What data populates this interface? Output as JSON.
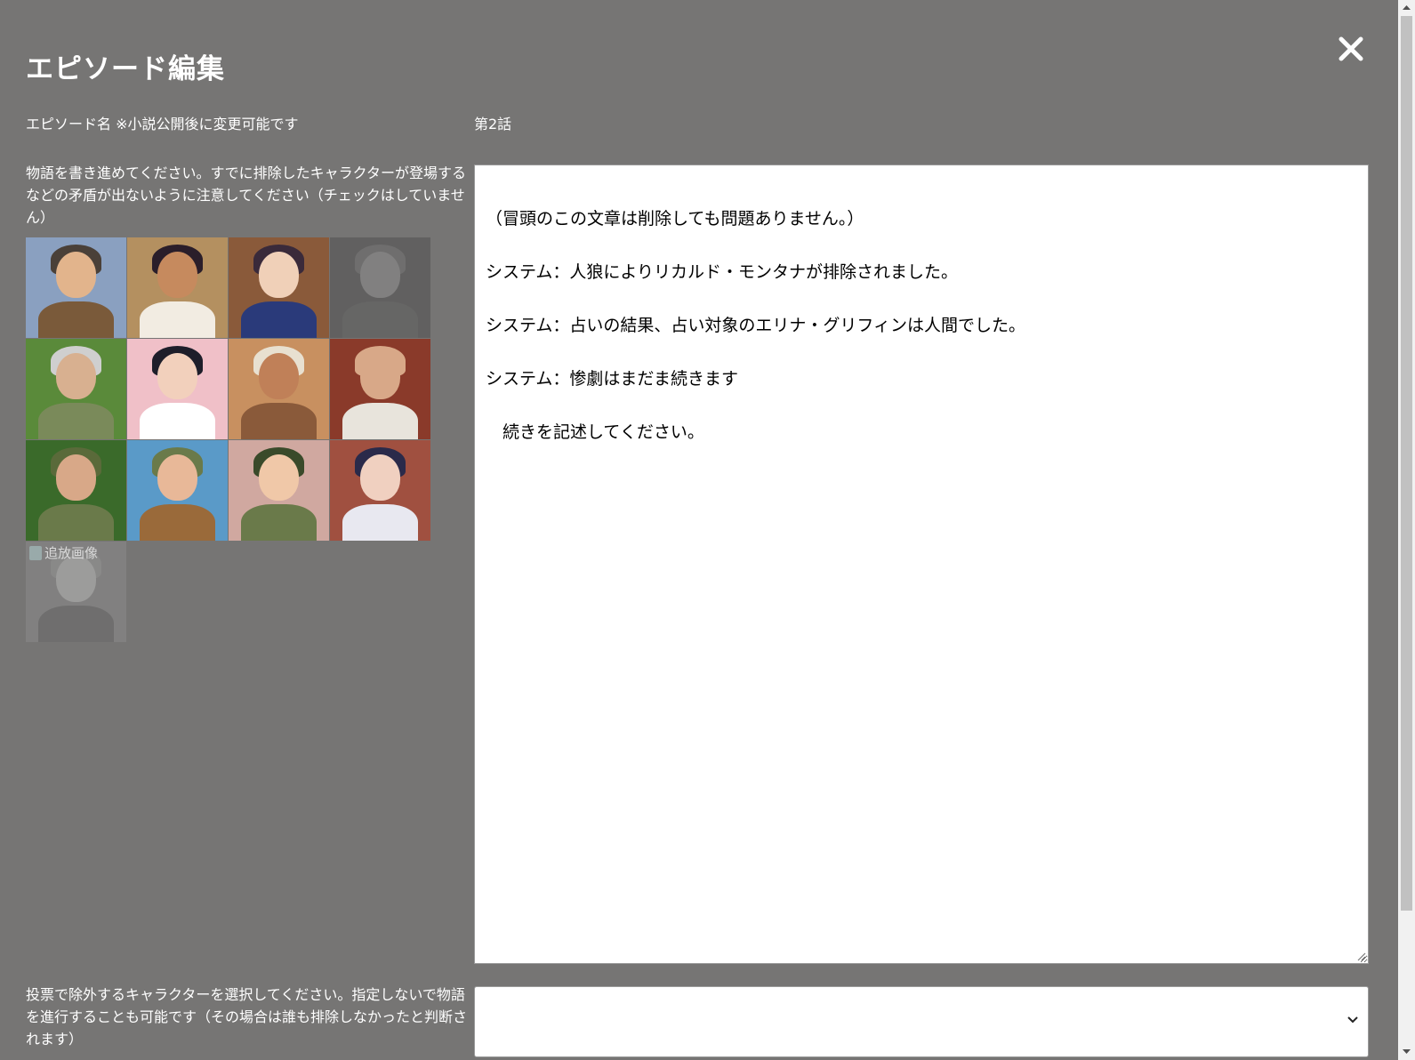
{
  "modal": {
    "title": "エピソード編集",
    "close_icon": "close-icon"
  },
  "episode": {
    "label": "エピソード名 ※小説公開後に変更可能です",
    "value": "第2話"
  },
  "story": {
    "instruction": "物語を書き進めてください。すでに排除したキャラクターが登場するなどの矛盾が出ないように注意してください（チェックはしていません）",
    "text_lines": [
      "（冒頭のこの文章は削除しても問題ありません。）",
      "システム：人狼によりリカルド・モンタナが排除されました。",
      "システム：占いの結果、占い対象のエリナ・グリフィンは人間でした。",
      "システム：惨劇はまだま続きます",
      "　続きを記述してください。"
    ]
  },
  "characters": [
    {
      "name": "character-portrait-1",
      "bg": "#8aa0c0",
      "skin": "#e2b48c",
      "hair": "#4a4038",
      "cloth": "#7a5a3a",
      "excluded": false
    },
    {
      "name": "character-portrait-2",
      "bg": "#b49060",
      "skin": "#c68a5e",
      "hair": "#2a1e2a",
      "cloth": "#f2ece2",
      "excluded": false
    },
    {
      "name": "character-portrait-3",
      "bg": "#8a5a3a",
      "skin": "#f0d0b8",
      "hair": "#3a2a3a",
      "cloth": "#2a3a7a",
      "excluded": false
    },
    {
      "name": "character-portrait-4",
      "bg": "#505050",
      "skin": "#8a8a8a",
      "hair": "#6a6a6a",
      "cloth": "#5a5a5a",
      "excluded": true
    },
    {
      "name": "character-portrait-5",
      "bg": "#5a8a3a",
      "skin": "#d8b090",
      "hair": "#cfcfcf",
      "cloth": "#7a8a5a",
      "excluded": false
    },
    {
      "name": "character-portrait-6",
      "bg": "#f0c0c8",
      "skin": "#f2d0bc",
      "hair": "#1e1e2a",
      "cloth": "#ffffff",
      "excluded": false
    },
    {
      "name": "character-portrait-7",
      "bg": "#c89060",
      "skin": "#c08058",
      "hair": "#e8e0d0",
      "cloth": "#8a5a3a",
      "excluded": false
    },
    {
      "name": "character-portrait-8",
      "bg": "#8a3a2a",
      "skin": "#d8a888",
      "hair": "#d8a888",
      "cloth": "#e8e4dc",
      "excluded": false
    },
    {
      "name": "character-portrait-9",
      "bg": "#3a6a2a",
      "skin": "#d8a888",
      "hair": "#5a6a3a",
      "cloth": "#6a7a4a",
      "excluded": false
    },
    {
      "name": "character-portrait-10",
      "bg": "#5a9ac8",
      "skin": "#e8b898",
      "hair": "#6a7a4a",
      "cloth": "#9a6a3a",
      "excluded": false
    },
    {
      "name": "character-portrait-11",
      "bg": "#d0a8a0",
      "skin": "#f0c8a8",
      "hair": "#3a4a2a",
      "cloth": "#6a7a4a",
      "excluded": false
    },
    {
      "name": "character-portrait-12",
      "bg": "#a05040",
      "skin": "#f0d0c0",
      "hair": "#2a2a4a",
      "cloth": "#e8e8f0",
      "excluded": false
    },
    {
      "name": "character-portrait-13",
      "bg": "#8a8a8a",
      "skin": "#bcbcbc",
      "hair": "#9a9a9a",
      "cloth": "#6a6a6a",
      "excluded": true,
      "tag": "追放画像"
    }
  ],
  "vote": {
    "instruction": "投票で除外するキャラクターを選択してください。指定しないで物語を進行することも可能です（その場合は誰も排除しなかったと判断されます）",
    "selected": ""
  }
}
